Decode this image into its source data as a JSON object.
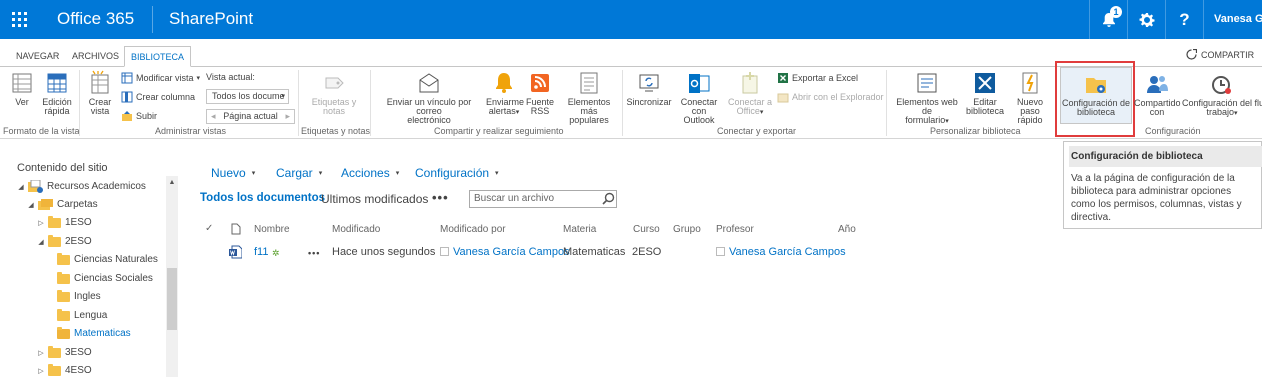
{
  "suitebar": {
    "app_launcher_icon": "waffle-icon",
    "office_title": "Office 365",
    "product_title": "SharePoint",
    "notification_count": "1",
    "help_label": "?",
    "user_name": "Vanesa Ga"
  },
  "ribbon_tabs": [
    "NAVEGAR",
    "ARCHIVOS",
    "BIBLIOTECA"
  ],
  "share_label": "COMPARTIR",
  "ribbon": {
    "groups": [
      "Formato de la vista",
      "Administrar vistas",
      "Etiquetas y notas",
      "Compartir y realizar seguimiento",
      "Conectar y exportar",
      "Personalizar biblioteca",
      "Configuración"
    ],
    "buttons": {
      "ver": "Ver",
      "edicion1": "Edición",
      "edicion2": "rápida",
      "crear_vista1": "Crear",
      "crear_vista2": "vista",
      "modificar_vista": "Modificar vista",
      "crear_columna": "Crear columna",
      "subir": "Subir",
      "vista_actual": "Vista actual:",
      "vista_actual_value": "Todos los docume",
      "pagina_actual": "Página actual",
      "etiquetas1": "Etiquetas y",
      "etiquetas2": "notas",
      "enviar1": "Enviar un vínculo por correo",
      "enviar2": "electrónico",
      "alertas1": "Enviarme",
      "alertas2": "alertas",
      "rss1": "Fuente",
      "rss2": "RSS",
      "populares1": "Elementos más",
      "populares2": "populares",
      "sincronizar": "Sincronizar",
      "outlook1": "Conectar con",
      "outlook2": "Outlook",
      "office1": "Conectar a",
      "office2": "Office",
      "exportar_excel": "Exportar a Excel",
      "abrir_explorador": "Abrir con el Explorador",
      "formulario1": "Elementos web de",
      "formulario2": "formulario",
      "editar_bib1": "Editar",
      "editar_bib2": "biblioteca",
      "nuevo_paso1": "Nuevo paso",
      "nuevo_paso2": "rápido",
      "config_bib1": "Configuración de",
      "config_bib2": "biblioteca",
      "compartido1": "Compartido",
      "compartido2": "con",
      "flujo1": "Configuración del flu",
      "flujo2": "trabajo"
    }
  },
  "tooltip": {
    "title": "Configuración de biblioteca",
    "body": "Va a la página de configuración de la biblioteca para administrar opciones como los permisos, columnas, vistas y directiva."
  },
  "leftnav": {
    "title": "Contenido del sitio",
    "items": [
      {
        "label": "Recursos Academicos"
      },
      {
        "label": "Carpetas"
      },
      {
        "label": "1ESO"
      },
      {
        "label": "2ESO"
      },
      {
        "label": "Ciencias Naturales"
      },
      {
        "label": "Ciencias Sociales"
      },
      {
        "label": "Ingles"
      },
      {
        "label": "Lengua"
      },
      {
        "label": "Matematicas"
      },
      {
        "label": "3ESO"
      },
      {
        "label": "4ESO"
      }
    ]
  },
  "commands": [
    "Nuevo",
    "Cargar",
    "Acciones",
    "Configuración"
  ],
  "views": {
    "active": "Todos los documentos",
    "other": "Ultimos modificados",
    "more": "•••",
    "search_placeholder": "Buscar un archivo"
  },
  "table": {
    "columns": [
      "Nombre",
      "Modificado",
      "Modificado por",
      "Materia",
      "Curso",
      "Grupo",
      "Profesor",
      "Año"
    ],
    "rows": [
      {
        "nombre": "f11",
        "new_marker": "✲",
        "menu": "•••",
        "modificado": "Hace unos segundos",
        "modificado_por": "Vanesa García Campos",
        "materia": "Matematicas",
        "curso": "2ESO",
        "grupo": "",
        "profesor": "Vanesa García Campos",
        "anio": ""
      }
    ]
  },
  "colors": {
    "suitebar": "#0078d7",
    "link": "#0072c6",
    "highlight": "#e03c3c",
    "folder": "#f5c24b"
  }
}
